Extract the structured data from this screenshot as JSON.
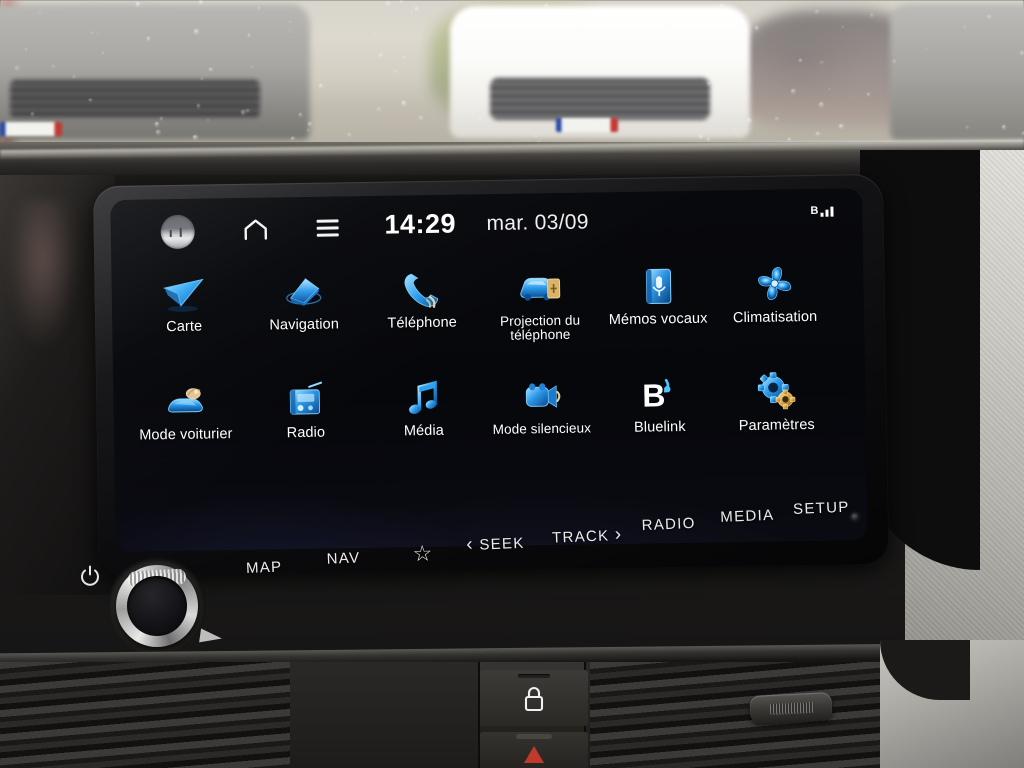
{
  "statusbar": {
    "avatar_name": "profile-avatar",
    "home_label": "home-icon",
    "menu_label": "menu-icon",
    "clock": "14:29",
    "date": "mar. 03/09",
    "bluetooth_label": "B",
    "signal_bars": 3
  },
  "apps": {
    "row1": [
      {
        "label": "Carte",
        "icon": "map-arrow-icon",
        "name": "app-carte"
      },
      {
        "label": "Navigation",
        "icon": "navigation-icon",
        "name": "app-navigation"
      },
      {
        "label": "Téléphone",
        "icon": "phone-icon",
        "name": "app-telephone"
      },
      {
        "label": "Projection du téléphone",
        "icon": "phone-projection-icon",
        "name": "app-projection-telephone"
      },
      {
        "label": "Mémos vocaux",
        "icon": "voice-memo-icon",
        "name": "app-memos-vocaux"
      },
      {
        "label": "Climatisation",
        "icon": "climate-fan-icon",
        "name": "app-climatisation"
      }
    ],
    "row2": [
      {
        "label": "Mode voiturier",
        "icon": "valet-mode-icon",
        "name": "app-mode-voiturier"
      },
      {
        "label": "Radio",
        "icon": "radio-icon",
        "name": "app-radio"
      },
      {
        "label": "Média",
        "icon": "media-note-icon",
        "name": "app-media"
      },
      {
        "label": "Mode silencieux",
        "icon": "quiet-mode-icon",
        "name": "app-mode-silencieux"
      },
      {
        "label": "Bluelink",
        "icon": "bluelink-icon",
        "name": "app-bluelink"
      },
      {
        "label": "Paramètres",
        "icon": "settings-gear-icon",
        "name": "app-parametres"
      }
    ]
  },
  "hardware_buttons": [
    {
      "label": "MAP",
      "name": "hw-button-map"
    },
    {
      "label": "NAV",
      "name": "hw-button-nav"
    },
    {
      "label": "SEEK",
      "name": "hw-button-seek"
    },
    {
      "label": "TRACK",
      "name": "hw-button-track"
    },
    {
      "label": "RADIO",
      "name": "hw-button-radio"
    },
    {
      "label": "MEDIA",
      "name": "hw-button-media"
    },
    {
      "label": "SETUP",
      "name": "hw-button-setup"
    }
  ],
  "hardware_glyphs": {
    "favorite": "☆",
    "seek_prev": "‹",
    "track_next": "›",
    "power": "power-icon",
    "volume_knob": "volume-knob"
  },
  "colors": {
    "screen_bg": "#08090d",
    "icon_blue": "#2196f3",
    "icon_cyan": "#4fc3f7",
    "accent_gold": "#d9a441",
    "text_white": "#ffffff",
    "hazard_red": "#c0392b"
  }
}
